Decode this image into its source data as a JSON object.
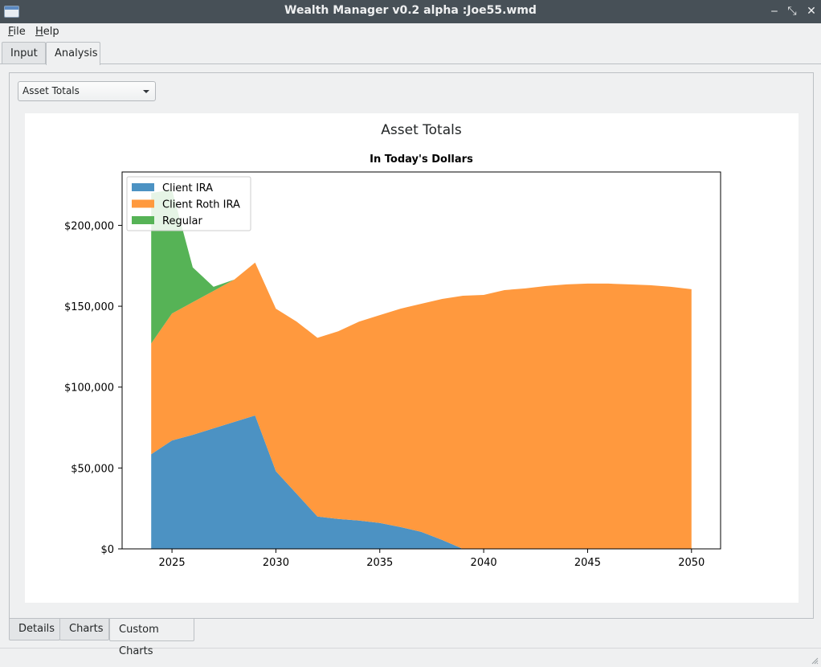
{
  "window": {
    "title": "Wealth Manager v0.2 alpha :Joe55.wmd",
    "minimize_glyph": "‒",
    "restore_glyph": "⤡",
    "close_glyph": "✕"
  },
  "menu": {
    "file": {
      "accel": "F",
      "rest": "ile"
    },
    "help": {
      "accel": "H",
      "rest": "elp"
    }
  },
  "top_tabs": [
    {
      "label": "Input",
      "active": false
    },
    {
      "label": "Analysis",
      "active": true
    }
  ],
  "chart_selector": {
    "value": "Asset Totals"
  },
  "bottom_tabs": [
    {
      "label": "Details",
      "active": false
    },
    {
      "label": "Charts",
      "active": false
    },
    {
      "label": "Custom Charts",
      "active": true
    }
  ],
  "chart_data": {
    "type": "area",
    "stacked": true,
    "title": "Asset Totals",
    "subtitle": "In Today's Dollars",
    "xlabel": "",
    "ylabel": "",
    "xlim": [
      2022.6,
      2051.4
    ],
    "ylim": [
      0,
      233000
    ],
    "x_ticks": [
      2025,
      2030,
      2035,
      2040,
      2045,
      2050
    ],
    "y_ticks": [
      {
        "value": 0,
        "label": "$0"
      },
      {
        "value": 50000,
        "label": "$50,000"
      },
      {
        "value": 100000,
        "label": "$100,000"
      },
      {
        "value": 150000,
        "label": "$150,000"
      },
      {
        "value": 200000,
        "label": "$200,000"
      }
    ],
    "legend_position": "top-left",
    "x": [
      2024,
      2025,
      2026,
      2027,
      2028,
      2029,
      2030,
      2031,
      2032,
      2033,
      2034,
      2035,
      2036,
      2037,
      2038,
      2039,
      2040,
      2041,
      2042,
      2043,
      2044,
      2045,
      2046,
      2047,
      2048,
      2049,
      2050
    ],
    "series": [
      {
        "name": "Client IRA",
        "color": "#4c92c3",
        "values": [
          58500,
          67000,
          70500,
          74500,
          78500,
          82500,
          48000,
          34000,
          20000,
          18500,
          17500,
          16000,
          13500,
          10500,
          5500,
          0,
          0,
          0,
          0,
          0,
          0,
          0,
          0,
          0,
          0,
          0,
          0
        ]
      },
      {
        "name": "Client Roth IRA",
        "color": "#ff993e",
        "values": [
          68500,
          78500,
          82000,
          85000,
          88000,
          94500,
          100500,
          106500,
          110500,
          116000,
          123000,
          128500,
          135000,
          141000,
          149000,
          156500,
          157000,
          160000,
          161000,
          162500,
          163500,
          164000,
          164000,
          163500,
          163000,
          162000,
          160500
        ]
      },
      {
        "name": "Regular",
        "color": "#56b356",
        "values": [
          93000,
          76500,
          21500,
          2500,
          0,
          0,
          0,
          0,
          0,
          0,
          0,
          0,
          0,
          0,
          0,
          0,
          0,
          0,
          0,
          0,
          0,
          0,
          0,
          0,
          0,
          0,
          0
        ]
      }
    ]
  }
}
